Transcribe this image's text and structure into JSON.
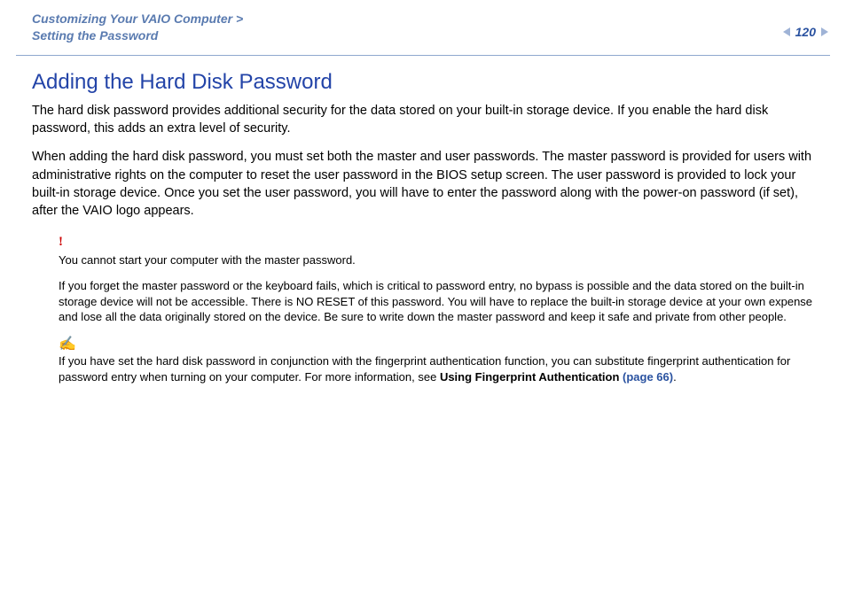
{
  "header": {
    "breadcrumb_line1": "Customizing Your VAIO Computer >",
    "breadcrumb_line2": "Setting the Password",
    "page_number": "120"
  },
  "section": {
    "title": "Adding the Hard Disk Password",
    "para1": "The hard disk password provides additional security for the data stored on your built-in storage device. If you enable the hard disk password, this adds an extra level of security.",
    "para2": "When adding the hard disk password, you must set both the master and user passwords. The master password is provided for users with administrative rights on the computer to reset the user password in the BIOS setup screen. The user password is provided to lock your built-in storage device. Once you set the user password, you will have to enter the password along with the power-on password (if set), after the VAIO logo appears."
  },
  "warning": {
    "mark": "!",
    "line1": "You cannot start your computer with the master password.",
    "line2": "If you forget the master password or the keyboard fails, which is critical to password entry, no bypass is possible and the data stored on the built-in storage device will not be accessible. There is NO RESET of this password. You will have to replace the built-in storage device at your own expense and lose all the data originally stored on the device. Be sure to write down the master password and keep it safe and private from other people."
  },
  "note": {
    "mark": "✍",
    "text_before_link": "If you have set the hard disk password in conjunction with the fingerprint authentication function, you can substitute fingerprint authentication for password entry when turning on your computer. For more information, see ",
    "link_label_bold": "Using Fingerprint Authentication ",
    "link_page": "(page 66)",
    "text_after_link": "."
  }
}
